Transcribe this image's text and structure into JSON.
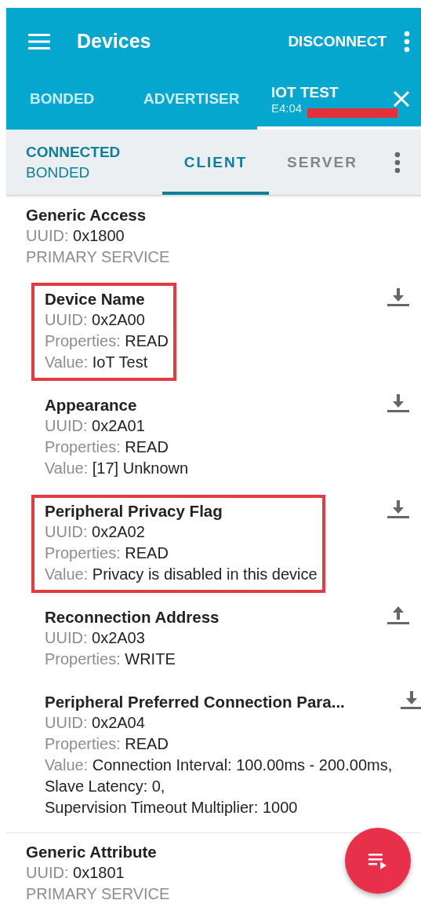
{
  "toolbar": {
    "title": "Devices",
    "action": "DISCONNECT"
  },
  "device_tabs": [
    {
      "label": "BONDED",
      "selected": false
    },
    {
      "label": "ADVERTISER",
      "selected": false
    },
    {
      "label": "IOT TEST",
      "subtitle": "E4:04",
      "selected": true,
      "redacted": true
    }
  ],
  "connection": {
    "status": "CONNECTED",
    "bond": "BONDED"
  },
  "mode_tabs": [
    {
      "label": "CLIENT",
      "selected": true
    },
    {
      "label": "SERVER",
      "selected": false
    }
  ],
  "services": [
    {
      "name": "Generic Access",
      "uuid_label": "UUID:",
      "uuid": "0x1800",
      "type": "PRIMARY SERVICE",
      "characteristics": [
        {
          "name": "Device Name",
          "highlighted": true,
          "kind": "read",
          "fields": [
            {
              "label": "UUID:",
              "value": "0x2A00"
            },
            {
              "label": "Properties:",
              "value": "READ"
            },
            {
              "label": "Value:",
              "value": "IoT Test"
            }
          ]
        },
        {
          "name": "Appearance",
          "highlighted": false,
          "kind": "read",
          "fields": [
            {
              "label": "UUID:",
              "value": "0x2A01"
            },
            {
              "label": "Properties:",
              "value": "READ"
            },
            {
              "label": "Value:",
              "value": "[17] Unknown"
            }
          ]
        },
        {
          "name": "Peripheral Privacy Flag",
          "highlighted": true,
          "kind": "read",
          "fields": [
            {
              "label": "UUID:",
              "value": "0x2A02"
            },
            {
              "label": "Properties:",
              "value": "READ"
            },
            {
              "label": "Value:",
              "value": "Privacy is disabled in this device"
            }
          ]
        },
        {
          "name": "Reconnection Address",
          "highlighted": false,
          "kind": "write",
          "fields": [
            {
              "label": "UUID:",
              "value": "0x2A03"
            },
            {
              "label": "Properties:",
              "value": "WRITE"
            }
          ]
        },
        {
          "name": "Peripheral Preferred Connection Para...",
          "highlighted": false,
          "kind": "read",
          "fields": [
            {
              "label": "UUID:",
              "value": "0x2A04"
            },
            {
              "label": "Properties:",
              "value": "READ"
            },
            {
              "label": "Value:",
              "value": "Connection Interval: 100.00ms - 200.00ms,",
              "more": [
                "Slave Latency: 0,",
                "Supervision Timeout Multiplier: 1000"
              ]
            }
          ]
        }
      ]
    },
    {
      "name": "Generic Attribute",
      "uuid_label": "UUID:",
      "uuid": "0x1801",
      "type": "PRIMARY SERVICE"
    }
  ]
}
